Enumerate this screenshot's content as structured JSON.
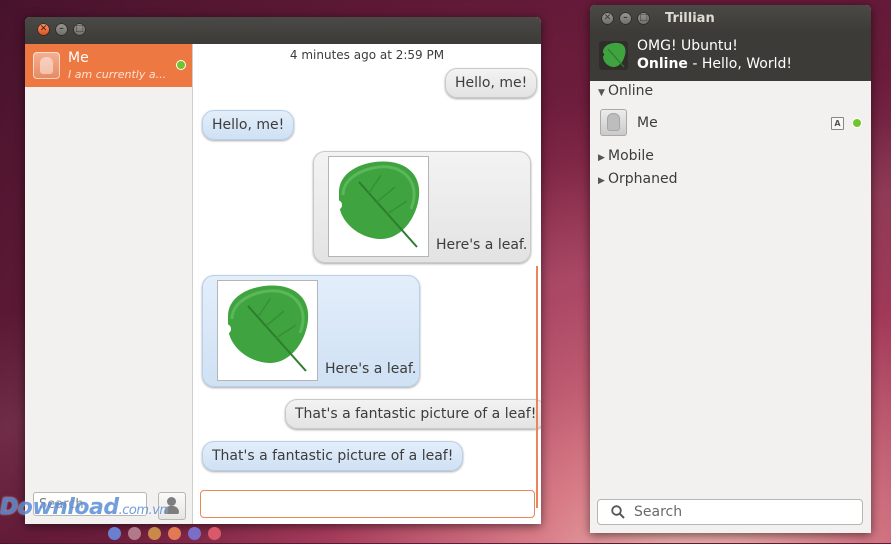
{
  "chat_window": {
    "contact": {
      "name": "Me",
      "status": "I am currently a...",
      "presence_color": "#6fc52a"
    },
    "timestamp": "4 minutes ago at 2:59 PM",
    "messages": [
      {
        "direction": "out",
        "kind": "text",
        "text": "Hello, me!"
      },
      {
        "direction": "in",
        "kind": "text",
        "text": "Hello, me!"
      },
      {
        "direction": "out",
        "kind": "image",
        "caption": "Here's a leaf."
      },
      {
        "direction": "in",
        "kind": "image",
        "caption": "Here's a leaf."
      },
      {
        "direction": "out",
        "kind": "text",
        "text": "That's a fantastic picture of a leaf!"
      },
      {
        "direction": "in",
        "kind": "text",
        "text": "That's a fantastic picture of a leaf!"
      }
    ],
    "search_placeholder": "Search",
    "compose_value": "",
    "compose_icons": [
      "camera-icon",
      "smiley-icon"
    ]
  },
  "trillian": {
    "title": "Trillian",
    "profile": {
      "name": "OMG! Ubuntu!",
      "status_bold": "Online",
      "status_rest": " - Hello, World!"
    },
    "groups": [
      {
        "label": "Online",
        "expanded": true
      },
      {
        "label": "Mobile",
        "expanded": false
      },
      {
        "label": "Orphaned",
        "expanded": false
      }
    ],
    "contacts": [
      {
        "name": "Me",
        "badge": "A"
      }
    ],
    "search_placeholder": "Search"
  },
  "watermark": {
    "text": "Download",
    "suffix": ".com.vn"
  },
  "colors": {
    "accent": "#ee7841",
    "title_bar": "#3c3b37",
    "online": "#6fc52a",
    "leaf": "#3fa33f"
  }
}
